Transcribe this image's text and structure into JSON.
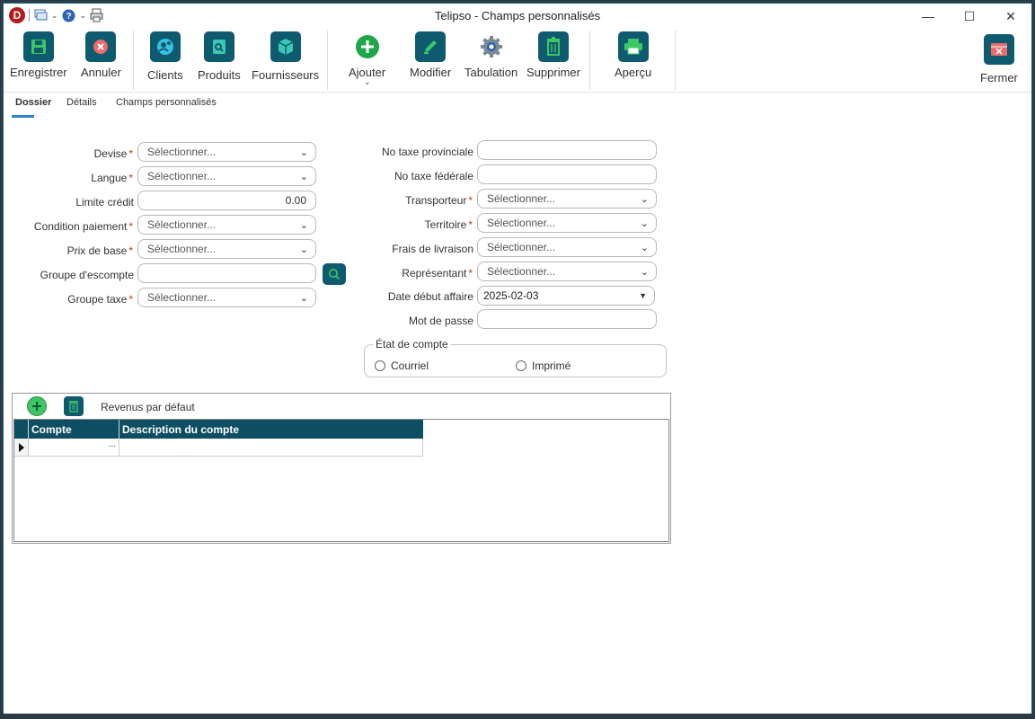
{
  "window": {
    "title": "Telipso - Champs personnalisés"
  },
  "qat": {
    "logo_letter": "D"
  },
  "window_controls": {
    "minimize": "—",
    "maximize": "☐",
    "close": "✕"
  },
  "ribbon": {
    "enregistrer": "Enregistrer",
    "annuler": "Annuler",
    "clients": "Clients",
    "produits": "Produits",
    "fournisseurs": "Fournisseurs",
    "ajouter": "Ajouter",
    "modifier": "Modifier",
    "tabulation": "Tabulation",
    "supprimer": "Supprimer",
    "apercu": "Aperçu",
    "fermer": "Fermer"
  },
  "tabs": {
    "dossier": "Dossier",
    "details": "Détails",
    "champs": "Champs personnalisés"
  },
  "left_form": {
    "devise": {
      "label": "Devise",
      "value": "Sélectionner..."
    },
    "langue": {
      "label": "Langue",
      "value": "Sélectionner..."
    },
    "limite_credit": {
      "label": "Limite crédit",
      "value": "0.00"
    },
    "condition_paiement": {
      "label": "Condition paiement",
      "value": "Sélectionner..."
    },
    "prix_base": {
      "label": "Prix de base",
      "value": "Sélectionner..."
    },
    "groupe_escompte": {
      "label": "Groupe d'escompte",
      "value": ""
    },
    "groupe_taxe": {
      "label": "Groupe taxe",
      "value": "Sélectionner..."
    }
  },
  "right_form": {
    "no_taxe_prov": {
      "label": "No taxe provinciale",
      "value": ""
    },
    "no_taxe_fed": {
      "label": "No taxe fédérale",
      "value": ""
    },
    "transporteur": {
      "label": "Transporteur",
      "value": "Sélectionner..."
    },
    "territoire": {
      "label": "Territoire",
      "value": "Sélectionner..."
    },
    "frais_livraison": {
      "label": "Frais de livraison",
      "value": "Sélectionner..."
    },
    "representant": {
      "label": "Représentant",
      "value": "Sélectionner..."
    },
    "date_debut": {
      "label": "Date début affaire",
      "value": "2025-02-03"
    },
    "mot_de_passe": {
      "label": "Mot de passe",
      "value": ""
    }
  },
  "required_mark": "*",
  "etat_compte": {
    "legend": "État de compte",
    "courriel": "Courriel",
    "imprime": "Imprimé"
  },
  "revenus": {
    "title": "Revenus par défaut",
    "col_compte": "Compte",
    "col_description": "Description du compte",
    "ellipsis": "..."
  },
  "colors": {
    "accent": "#0e5a6e",
    "green": "#3cc764",
    "required": "#c0392b"
  }
}
